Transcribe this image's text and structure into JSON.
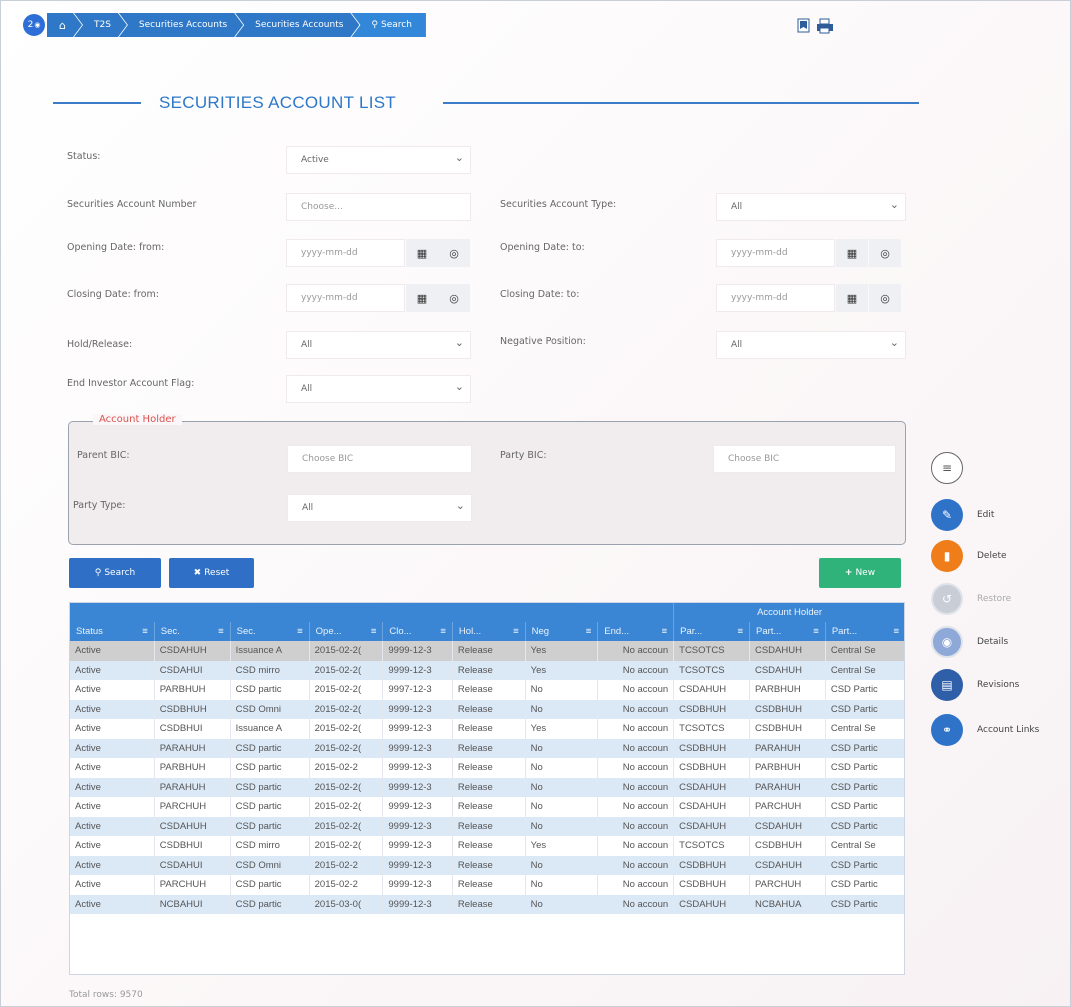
{
  "breadcrumb": {
    "badge": "2",
    "items": [
      "⌂",
      "T2S",
      "Securities Accounts",
      "Securities Accounts",
      "Search"
    ]
  },
  "page": {
    "title": "SECURITIES ACCOUNT LIST"
  },
  "form": {
    "status": {
      "label": "Status:",
      "value": "Active"
    },
    "account_number": {
      "label": "Securities Account Number",
      "placeholder": "Choose..."
    },
    "account_type": {
      "label": "Securities Account Type:",
      "value": "All"
    },
    "opening_from": {
      "label": "Opening Date: from:",
      "placeholder": "yyyy-mm-dd"
    },
    "opening_to": {
      "label": "Opening Date: to:",
      "placeholder": "yyyy-mm-dd"
    },
    "closing_from": {
      "label": "Closing Date: from:",
      "placeholder": "yyyy-mm-dd"
    },
    "closing_to": {
      "label": "Closing Date: to:",
      "placeholder": "yyyy-mm-dd"
    },
    "hold_release": {
      "label": "Hold/Release:",
      "value": "All"
    },
    "negative_position": {
      "label": "Negative Position:",
      "value": "All"
    },
    "end_investor": {
      "label": "End Investor Account Flag:",
      "value": "All"
    }
  },
  "account_holder": {
    "legend": "Account Holder",
    "parent_bic": {
      "label": "Parent BIC:",
      "placeholder": "Choose BIC"
    },
    "party_bic": {
      "label": "Party BIC:",
      "placeholder": "Choose BIC"
    },
    "party_type": {
      "label": "Party Type:",
      "value": "All"
    }
  },
  "buttons": {
    "search": "Search",
    "reset": "Reset",
    "new": "New"
  },
  "table": {
    "group_header": "Account Holder",
    "columns": [
      "Status",
      "Sec.",
      "Sec.",
      "Ope...",
      "Clo...",
      "Hol...",
      "Neg",
      "End...",
      "Par...",
      "Part...",
      "Part..."
    ],
    "rows": [
      [
        "Active",
        "CSDAHUH",
        "Issuance A",
        "2015-02-2(",
        "9999-12-3",
        "Release",
        "Yes",
        "No accoun",
        "TCSOTCS",
        "CSDAHUH",
        "Central Se"
      ],
      [
        "Active",
        "CSDAHUI",
        "CSD mirro",
        "2015-02-2(",
        "9999-12-3",
        "Release",
        "Yes",
        "No accoun",
        "TCSOTCS",
        "CSDAHUH",
        "Central Se"
      ],
      [
        "Active",
        "PARBHUH",
        "CSD partic",
        "2015-02-2(",
        "9997-12-3",
        "Release",
        "No",
        "No accoun",
        "CSDAHUH",
        "PARBHUH",
        "CSD Partic"
      ],
      [
        "Active",
        "CSDBHUH",
        "CSD Omni",
        "2015-02-2(",
        "9999-12-3",
        "Release",
        "No",
        "No accoun",
        "CSDBHUH",
        "CSDBHUH",
        "CSD Partic"
      ],
      [
        "Active",
        "CSDBHUI",
        "Issuance A",
        "2015-02-2(",
        "9999-12-3",
        "Release",
        "Yes",
        "No accoun",
        "TCSOTCS",
        "CSDBHUH",
        "Central Se"
      ],
      [
        "Active",
        "PARAHUH",
        "CSD partic",
        "2015-02-2(",
        "9999-12-3",
        "Release",
        "No",
        "No accoun",
        "CSDBHUH",
        "PARAHUH",
        "CSD Partic"
      ],
      [
        "Active",
        "PARBHUH",
        "CSD partic",
        "2015-02-2",
        "9999-12-3",
        "Release",
        "No",
        "No accoun",
        "CSDBHUH",
        "PARBHUH",
        "CSD Partic"
      ],
      [
        "Active",
        "PARAHUH",
        "CSD partic",
        "2015-02-2(",
        "9999-12-3",
        "Release",
        "No",
        "No accoun",
        "CSDAHUH",
        "PARAHUH",
        "CSD Partic"
      ],
      [
        "Active",
        "PARCHUH",
        "CSD partic",
        "2015-02-2(",
        "9999-12-3",
        "Release",
        "No",
        "No accoun",
        "CSDAHUH",
        "PARCHUH",
        "CSD Partic"
      ],
      [
        "Active",
        "CSDAHUH",
        "CSD partic",
        "2015-02-2(",
        "9999-12-3",
        "Release",
        "No",
        "No accoun",
        "CSDAHUH",
        "CSDAHUH",
        "CSD Partic"
      ],
      [
        "Active",
        "CSDBHUI",
        "CSD mirro",
        "2015-02-2(",
        "9999-12-3",
        "Release",
        "Yes",
        "No accoun",
        "TCSOTCS",
        "CSDBHUH",
        "Central Se"
      ],
      [
        "Active",
        "CSDAHUI",
        "CSD Omni",
        "2015-02-2",
        "9999-12-3",
        "Release",
        "No",
        "No accoun",
        "CSDBHUH",
        "CSDAHUH",
        "CSD Partic"
      ],
      [
        "Active",
        "PARCHUH",
        "CSD partic",
        "2015-02-2",
        "9999-12-3",
        "Release",
        "No",
        "No accoun",
        "CSDBHUH",
        "PARCHUH",
        "CSD Partic"
      ],
      [
        "Active",
        "NCBAHUI",
        "CSD partic",
        "2015-03-0(",
        "9999-12-3",
        "Release",
        "No",
        "No accoun",
        "CSDAHUH",
        "NCBAHUA",
        "CSD Partic"
      ]
    ]
  },
  "total_rows": "Total rows: 9570",
  "side_menu": [
    {
      "label": "",
      "icon": "menu-icon",
      "color": "#ffffff"
    },
    {
      "label": "Edit",
      "icon": "edit-icon",
      "color": "#2f73c9"
    },
    {
      "label": "Delete",
      "icon": "delete-icon",
      "color": "#ee7d1a"
    },
    {
      "label": "Restore",
      "icon": "restore-icon",
      "color": "#c8cdd6"
    },
    {
      "label": "Details",
      "icon": "details-icon",
      "color": "#8ea9d8"
    },
    {
      "label": "Revisions",
      "icon": "revisions-icon",
      "color": "#2f5fa9"
    },
    {
      "label": "Account Links",
      "icon": "link-icon",
      "color": "#2f73c9"
    }
  ]
}
